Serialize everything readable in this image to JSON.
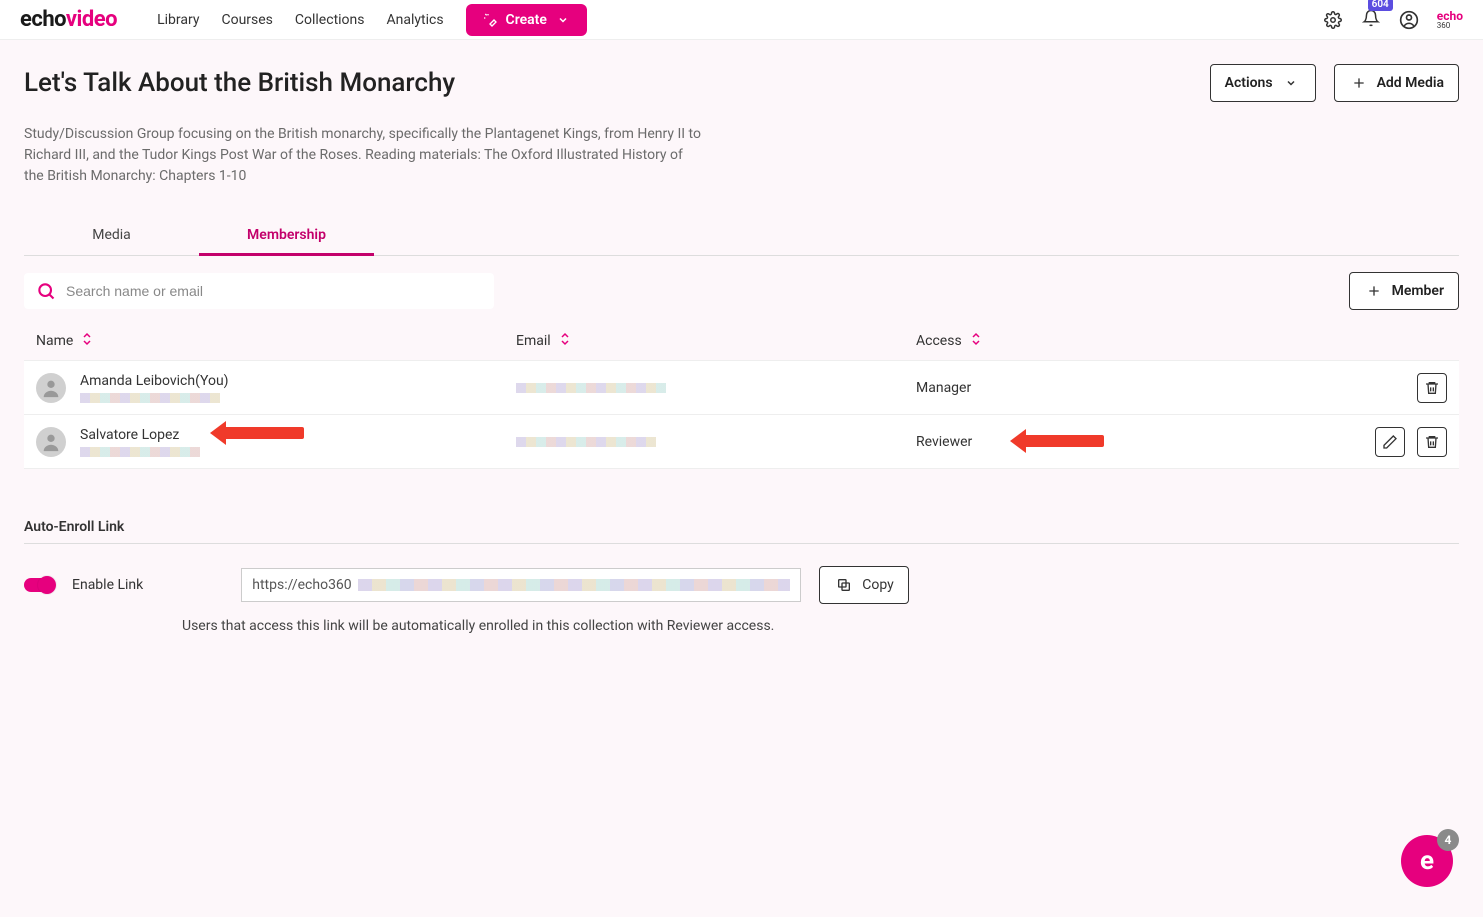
{
  "nav": {
    "logo_part1": "echo",
    "logo_part2": "video",
    "links": [
      "Library",
      "Courses",
      "Collections",
      "Analytics"
    ],
    "create_label": "Create",
    "notif_count": "604",
    "small_logo_top": "echo",
    "small_logo_bottom": "360"
  },
  "page": {
    "title": "Let's Talk About the British Monarchy",
    "actions_label": "Actions",
    "add_media_label": "Add Media",
    "description": "Study/Discussion Group focusing on the British monarchy, specifically the Plantagenet Kings, from Henry II to Richard III, and the Tudor Kings Post War of the Roses. Reading materials: The Oxford Illustrated History of the British Monarchy: Chapters 1-10"
  },
  "tabs": {
    "media": "Media",
    "membership": "Membership"
  },
  "search": {
    "placeholder": "Search name or email"
  },
  "member_btn_label": "Member",
  "table": {
    "columns": {
      "name": "Name",
      "email": "Email",
      "access": "Access"
    },
    "rows": [
      {
        "name": "Amanda Leibovich(You)",
        "access": "Manager",
        "editable": false
      },
      {
        "name": "Salvatore Lopez",
        "access": "Reviewer",
        "editable": true
      }
    ]
  },
  "auto_enroll": {
    "section_title": "Auto-Enroll Link",
    "enable_label": "Enable Link",
    "link_prefix": "https://echo360",
    "copy_label": "Copy",
    "helper": "Users that access this link will be automatically enrolled in this collection with Reviewer access."
  },
  "float": {
    "glyph": "e",
    "count": "4"
  }
}
